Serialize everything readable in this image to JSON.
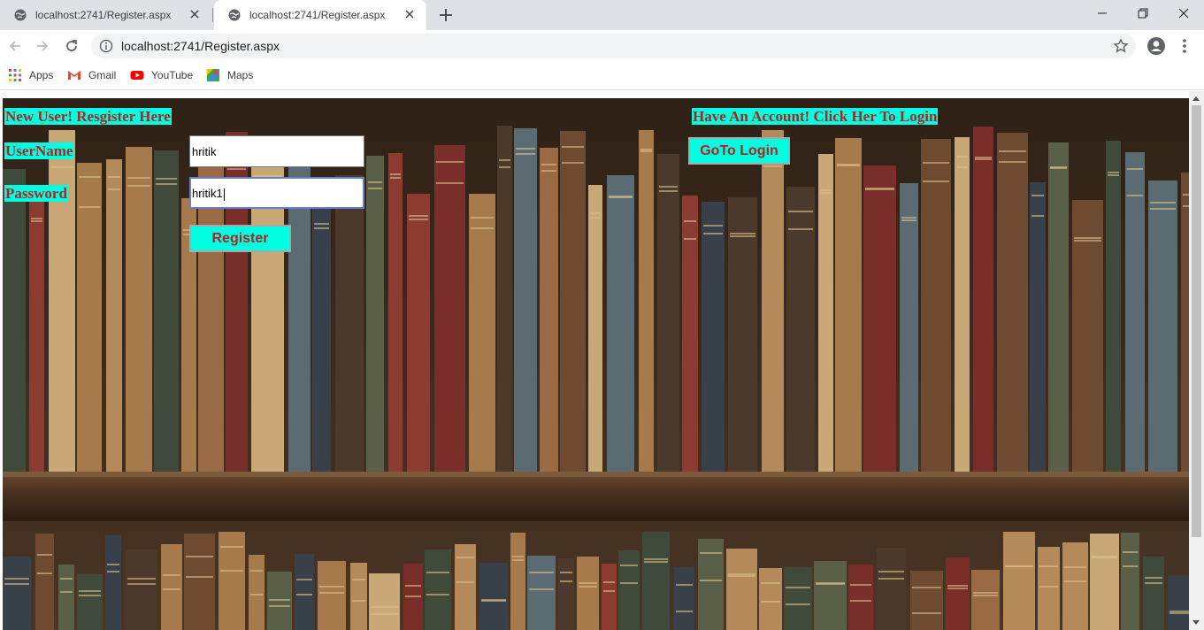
{
  "browser": {
    "tabs": [
      {
        "title": "localhost:2741/Register.aspx",
        "active": false
      },
      {
        "title": "localhost:2741/Register.aspx",
        "active": true
      }
    ],
    "address": "localhost:2741/Register.aspx",
    "bookmarks": [
      {
        "label": "Apps",
        "icon": "apps-grid-icon"
      },
      {
        "label": "Gmail",
        "icon": "gmail-icon"
      },
      {
        "label": "YouTube",
        "icon": "youtube-icon"
      },
      {
        "label": "Maps",
        "icon": "maps-icon"
      }
    ]
  },
  "page": {
    "register_heading": "New User! Resgister Here",
    "login_heading": "Have An Account! Click Her To Login",
    "username_label": "UserName",
    "password_label": "Password",
    "username_value": "hritik",
    "password_value": "hritik1",
    "register_button": "Register",
    "goto_login_button": "GoTo Login",
    "colors": {
      "label_bg": "#00ffe0",
      "label_text": "#b22222"
    }
  }
}
